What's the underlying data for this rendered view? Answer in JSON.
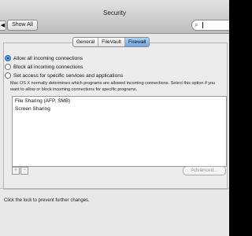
{
  "window": {
    "title": "Security"
  },
  "toolbar": {
    "back_label": "◀",
    "show_all_label": "Show All"
  },
  "search": {
    "icon": "search-icon",
    "icon_glyph": "⌕",
    "value": ""
  },
  "tabs": [
    {
      "label": "General",
      "selected": false
    },
    {
      "label": "FileVault",
      "selected": false
    },
    {
      "label": "Firewall",
      "selected": true
    }
  ],
  "firewall": {
    "options": [
      {
        "label": "Allow all incoming connections",
        "selected": true
      },
      {
        "label": "Block all incoming connections",
        "selected": false
      },
      {
        "label": "Set access for specific services and applications",
        "selected": false
      }
    ],
    "description": "Mac OS X normally determines which programs are allowed incoming connections. Select this option if you want to allow or block incoming connections for specific programs.",
    "services": [
      "File Sharing (AFP, SMB)",
      "Screen Sharing"
    ],
    "add_label": "+",
    "remove_label": "−",
    "advanced_label": "Advanced..."
  },
  "footer": {
    "lock_message": "Click the lock to prevent further changes."
  },
  "colors": {
    "selected_tab": "#6fa6e2",
    "radio_selected": "#5c9ae0",
    "background": "#e8e8e8"
  }
}
